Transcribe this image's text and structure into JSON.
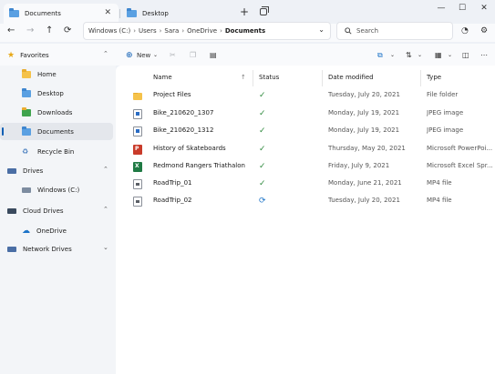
{
  "tabs": [
    {
      "label": "Documents",
      "active": true
    },
    {
      "label": "Desktop",
      "active": false
    }
  ],
  "window_controls": {
    "minimize": "—",
    "maximize": "☐",
    "close": "✕"
  },
  "nav": {
    "back": "←",
    "forward": "→",
    "up": "↑",
    "refresh": "⟳"
  },
  "address": {
    "crumbs": [
      "Windows (C:)",
      "Users",
      "Sara",
      "OneDrive",
      "Documents"
    ]
  },
  "search": {
    "placeholder": "Search"
  },
  "commandbar": {
    "new_label": "New"
  },
  "sidebar": {
    "sections": [
      {
        "label": "Favorites",
        "icon": "star-icon"
      },
      {
        "label": "Drives",
        "icon": "drive-icon"
      },
      {
        "label": "Cloud Drives",
        "icon": "cloud-icon"
      },
      {
        "label": "Network Drives",
        "icon": "network-icon"
      }
    ],
    "favorites": [
      "Home",
      "Desktop",
      "Downloads",
      "Documents",
      "Recycle Bin"
    ],
    "drives": [
      "Windows (C:)"
    ],
    "cloud": [
      "OneDrive"
    ],
    "selected": "Documents"
  },
  "columns": {
    "name": "Name",
    "status": "Status",
    "date": "Date modified",
    "type": "Type"
  },
  "files": [
    {
      "name": "Project Files",
      "status": "synced",
      "date": "Tuesday, July 20, 2021",
      "type": "File folder",
      "icon": "folder-icon"
    },
    {
      "name": "Bike_210620_1307",
      "status": "synced",
      "date": "Monday, July 19, 2021",
      "type": "JPEG image",
      "icon": "image-file-icon"
    },
    {
      "name": "Bike_210620_1312",
      "status": "synced",
      "date": "Monday, July 19, 2021",
      "type": "JPEG image",
      "icon": "image-file-icon"
    },
    {
      "name": "History of Skateboards",
      "status": "synced",
      "date": "Thursday, May 20, 2021",
      "type": "Microsoft PowerPoi...",
      "icon": "powerpoint-file-icon"
    },
    {
      "name": "Redmond Rangers Triathalon",
      "status": "synced",
      "date": "Friday, July 9, 2021",
      "type": "Microsoft Excel Spr...",
      "icon": "excel-file-icon"
    },
    {
      "name": "RoadTrip_01",
      "status": "synced",
      "date": "Monday, June 21, 2021",
      "type": "MP4 file",
      "icon": "video-file-icon"
    },
    {
      "name": "RoadTrip_02",
      "status": "syncing",
      "date": "Tuesday, July 20, 2021",
      "type": "MP4 file",
      "icon": "video-file-icon"
    }
  ],
  "colors": {
    "accent": "#0f5fb4",
    "synced": "#2f8a3e",
    "syncing": "#1d74c8",
    "folder": "#f5c24a"
  }
}
